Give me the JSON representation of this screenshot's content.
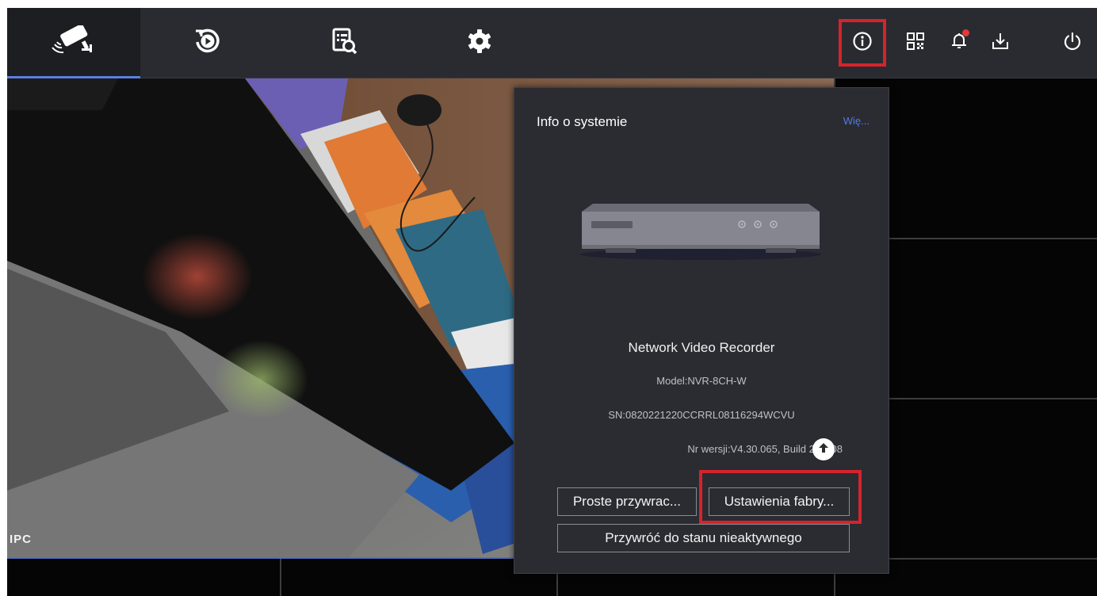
{
  "toolbar": {
    "tabs": [
      {
        "icon": "camera-icon",
        "active": true
      },
      {
        "icon": "playback-icon",
        "active": false
      },
      {
        "icon": "search-file-icon",
        "active": false
      },
      {
        "icon": "gear-icon",
        "active": false
      }
    ],
    "right_buttons": [
      {
        "icon": "info-icon",
        "highlighted": true
      },
      {
        "icon": "qr-code-icon",
        "highlighted": false
      },
      {
        "icon": "bell-icon",
        "alarm": true
      },
      {
        "icon": "download-icon",
        "highlighted": false
      },
      {
        "icon": "power-icon",
        "highlighted": false
      }
    ]
  },
  "live_view": {
    "channel_label": "IPC"
  },
  "info_panel": {
    "title": "Info o systemie",
    "more_link": "Wię...",
    "device_name": "Network Video Recorder",
    "model": "Model:NVR-8CH-W",
    "serial": "SN:0820221220CCRRL08116294WCVU",
    "version": "Nr wersji:V4.30.065, Build 221108",
    "buttons": {
      "simple_restore": "Proste przywrac...",
      "factory_settings": "Ustawienia fabry...",
      "restore_inactive": "Przywróć do stanu nieaktywnego"
    }
  },
  "colors": {
    "toolbar_bg": "#2a2b30",
    "accent": "#5b7fe0",
    "highlight": "#d4242c",
    "panel_bg": "#2b2c32",
    "link": "#4e7ce6"
  }
}
